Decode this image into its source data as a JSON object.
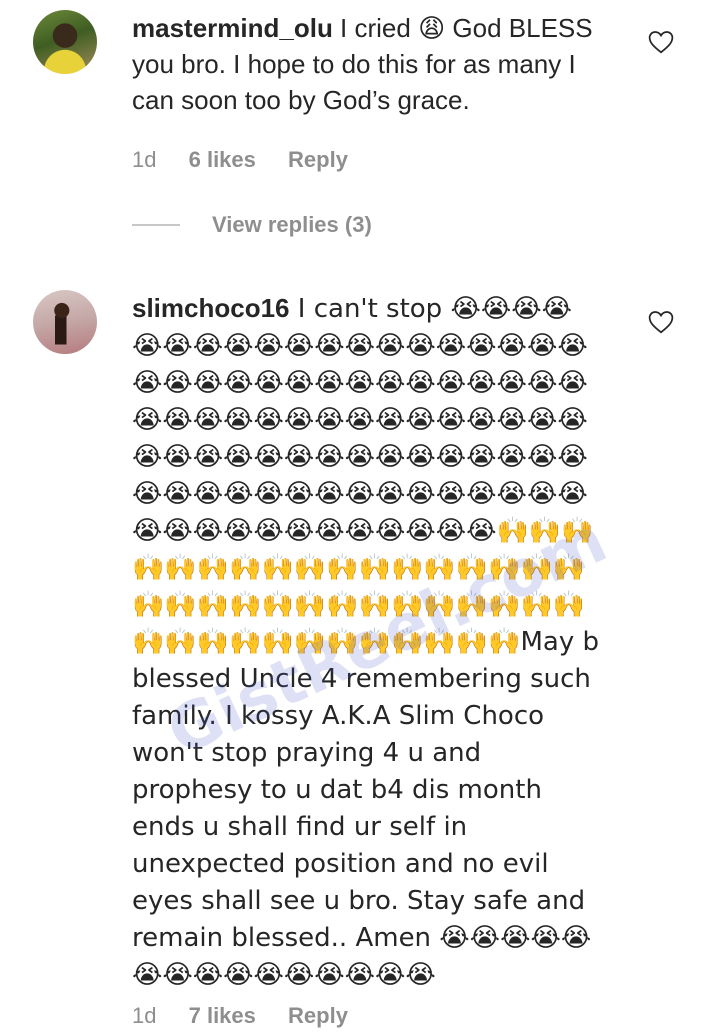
{
  "comments": [
    {
      "username": "mastermind_olu",
      "text": " I cried 😩 God BLESS you bro. I hope to do this for as many I can soon too by God’s grace.",
      "time": "1d",
      "likes": "6 likes",
      "reply": "Reply",
      "view_replies": "View replies (3)"
    },
    {
      "username": "slimchoco16",
      "text": " I can't stop 😭😭😭😭😭😭😭😭😭😭😭😭😭😭😭😭😭😭😭😭😭😭😭😭😭😭😭😭😭😭😭😭😭😭😭😭😭😭😭😭😭😭😭😭😭😭😭😭😭😭😭😭😭😭😭😭😭😭😭😭😭😭😭😭😭😭😭😭😭😭😭😭😭😭😭😭😭😭😭😭😭😭😭😭😭😭😭😭😭😭😭🙌🙌🙌🙌🙌🙌🙌🙌🙌🙌🙌🙌🙌🙌🙌🙌🙌🙌🙌🙌🙌🙌🙌🙌🙌🙌🙌🙌🙌🙌🙌🙌🙌🙌🙌🙌🙌🙌🙌🙌🙌🙌🙌May b blessed Uncle 4 remembering such family. I kossy A.K.A Slim Choco won't stop praying 4 u and prophesy to u dat b4 dis month ends u shall find ur self in unexpected position and no evil eyes shall see u bro. Stay safe and remain blessed.. Amen 😭😭😭😭😭😭😭😭😭😭😭😭😭😭😭",
      "time": "1d",
      "likes": "7 likes",
      "reply": "Reply"
    }
  ],
  "watermark": "GistReel.com",
  "icons": {
    "like": "heart-outline-icon"
  }
}
